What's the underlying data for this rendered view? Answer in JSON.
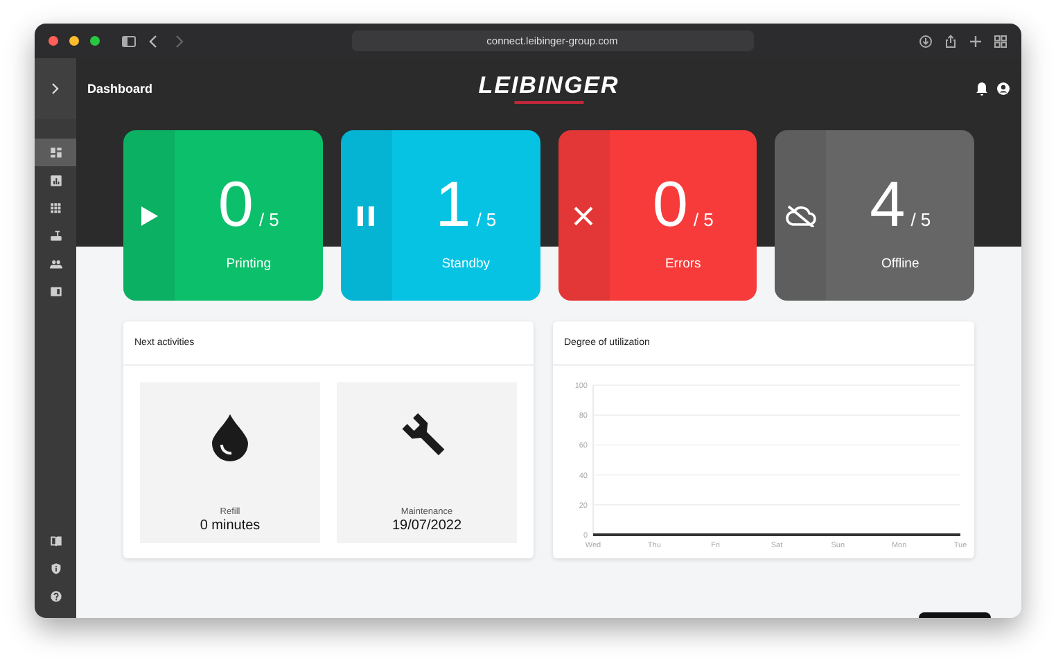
{
  "browser": {
    "url": "connect.leibinger-group.com"
  },
  "header": {
    "title": "Dashboard",
    "logo": "LEIBINGER"
  },
  "sidebar": {
    "items": [
      {
        "kind": "dashboard",
        "selected": true
      },
      {
        "kind": "chart",
        "selected": false
      },
      {
        "kind": "grid",
        "selected": false
      },
      {
        "kind": "printer",
        "selected": false
      },
      {
        "kind": "people",
        "selected": false
      },
      {
        "kind": "panel",
        "selected": false
      }
    ],
    "bottom_items": [
      {
        "kind": "book"
      },
      {
        "kind": "shield"
      },
      {
        "kind": "help"
      }
    ]
  },
  "status_cards": [
    {
      "kind": "play",
      "count": "0",
      "total": "/ 5",
      "label": "Printing",
      "color": "#0cbf6b"
    },
    {
      "kind": "pause",
      "count": "1",
      "total": "/ 5",
      "label": "Standby",
      "color": "#06c3e4"
    },
    {
      "kind": "error",
      "count": "0",
      "total": "/ 5",
      "label": "Errors",
      "color": "#f73b3b"
    },
    {
      "kind": "offline",
      "count": "4",
      "total": "/ 5",
      "label": "Offline",
      "color": "#666666"
    }
  ],
  "next_activities": {
    "title": "Next activities",
    "items": [
      {
        "kind": "drop",
        "label": "Refill",
        "value": "0 minutes"
      },
      {
        "kind": "wrench",
        "label": "Maintenance",
        "value": "19/07/2022"
      }
    ]
  },
  "utilization": {
    "title": "Degree of utilization",
    "chart_data": {
      "type": "line",
      "categories": [
        "Wed",
        "Thu",
        "Fri",
        "Sat",
        "Sun",
        "Mon",
        "Tue"
      ],
      "grid": true,
      "series": [
        {
          "color": "#333333",
          "values": [
            0,
            0,
            0,
            0,
            0,
            0,
            0
          ]
        }
      ],
      "ylim": [
        0,
        100
      ],
      "yticks": [
        0,
        20,
        40,
        60,
        80,
        100
      ]
    }
  }
}
